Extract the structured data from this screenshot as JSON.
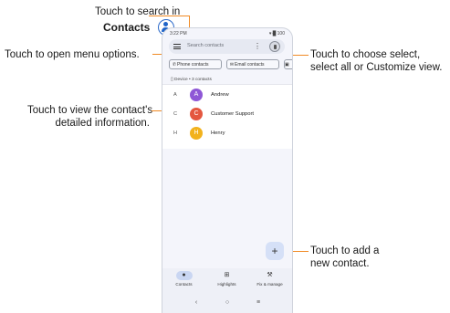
{
  "callouts": {
    "search_line1": "Touch to search in",
    "search_line2": "Contacts",
    "menu": "Touch to open menu options.",
    "choose_line1": "Touch to choose select,",
    "choose_line2": "select all or Customize view.",
    "view_line1": "Touch to view the contact's",
    "view_line2": "detailed information.",
    "add_line1": "Touch to add a",
    "add_line2": "new contact."
  },
  "status_bar": {
    "time": "3:22 PM",
    "icons": "▾∙█ 100"
  },
  "search": {
    "placeholder": "Search contacts"
  },
  "chips": [
    "Phone contacts",
    "Email contacts",
    "▣ "
  ],
  "device": {
    "label": "Device • 3 contacts"
  },
  "contacts": [
    {
      "letter": "A",
      "initial": "A",
      "name": "Andrew",
      "color": "#8e57d6"
    },
    {
      "letter": "C",
      "initial": "C",
      "name": "Customer Support",
      "color": "#e4573f"
    },
    {
      "letter": "H",
      "initial": "H",
      "name": "Henry",
      "color": "#f2b21c"
    }
  ],
  "fab": {
    "label": "+"
  },
  "bottom_nav": [
    {
      "label": "Contacts",
      "icon": "person-icon",
      "glyph": "●",
      "active": true
    },
    {
      "label": "Highlights",
      "icon": "highlights-icon",
      "glyph": "⊞",
      "active": false
    },
    {
      "label": "Fix & manage",
      "icon": "wrench-icon",
      "glyph": "⚒",
      "active": false
    }
  ],
  "system_nav": {
    "back": "‹",
    "home": "○",
    "recents": "≡"
  },
  "colors": {
    "accent_leader": "#f08a24",
    "active_nav": "#c9d6f2"
  }
}
